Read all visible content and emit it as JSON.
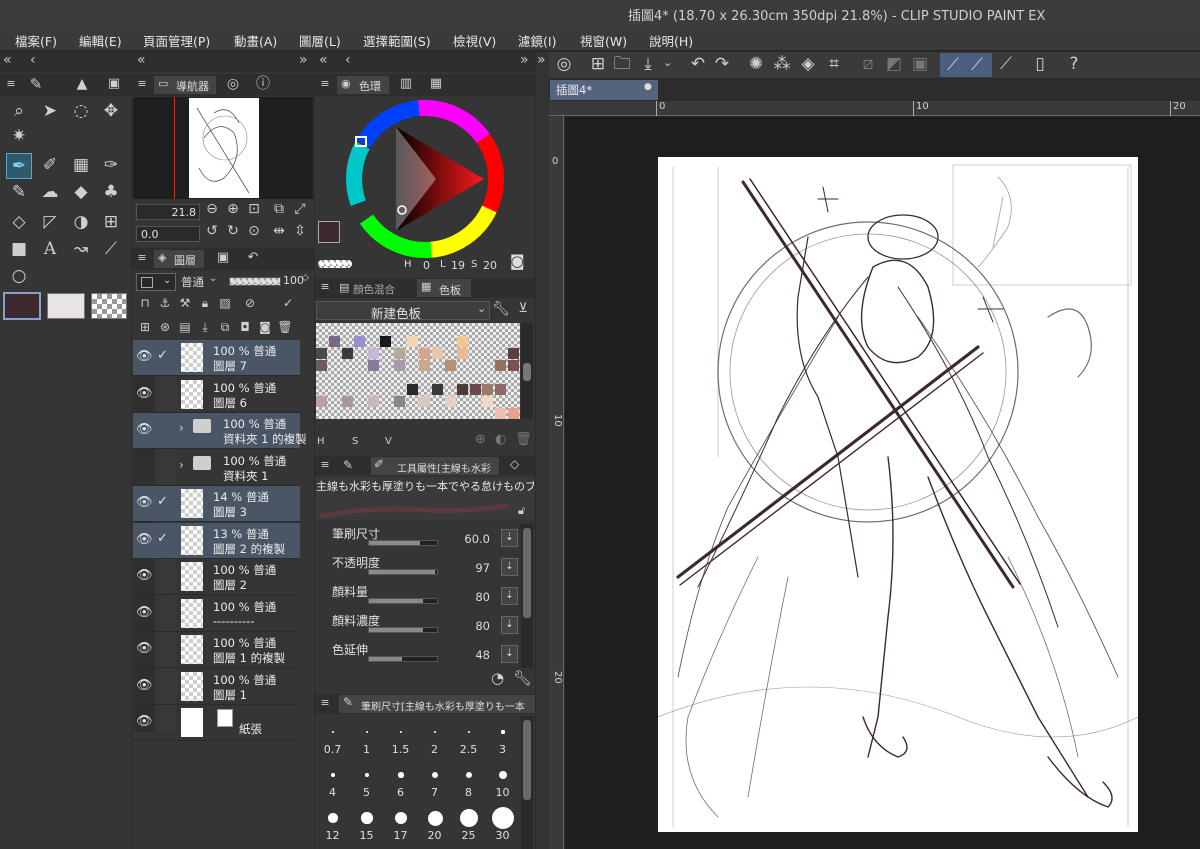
{
  "window": {
    "title": "插圖4* (18.70 x 26.30cm 350dpi 21.8%) - CLIP STUDIO PAINT EX"
  },
  "menu": [
    "檔案(F)",
    "編輯(E)",
    "頁面管理(P)",
    "動畫(A)",
    "圖層(L)",
    "選擇範圍(S)",
    "檢視(V)",
    "濾鏡(I)",
    "視窗(W)",
    "說明(H)"
  ],
  "navigator": {
    "tab": "導航器",
    "zoom": "21.8",
    "rotation": "0.0"
  },
  "color": {
    "tab": "色環",
    "h": "0",
    "l": "19",
    "s": "20",
    "main_color": "#3d2a2e",
    "sub_color": "#e8e4e6"
  },
  "layers": {
    "tab": "圖層",
    "blend": "普通",
    "opacity": "100",
    "rows": [
      {
        "line1": "100 % 普通",
        "line2": "圖層 7",
        "selected": true,
        "checked": true
      },
      {
        "line1": "100 % 普通",
        "line2": "圖層 6",
        "selected": false,
        "checked": false
      },
      {
        "line1": "100 % 普通",
        "line2": "資料夾 1 的複製",
        "selected": true,
        "checked": false,
        "folder": true
      },
      {
        "line1": "100 % 普通",
        "line2": "資料夾 1",
        "selected": false,
        "checked": false,
        "folder": true,
        "hidden": true
      },
      {
        "line1": "14 % 普通",
        "line2": "圖層 3",
        "selected": true,
        "checked": true
      },
      {
        "line1": "13 % 普通",
        "line2": "圖層 2 的複製",
        "selected": true,
        "checked": true
      },
      {
        "line1": "100 % 普通",
        "line2": "圖層 2",
        "selected": false,
        "checked": false
      },
      {
        "line1": "100 % 普通",
        "line2": "----------",
        "selected": false,
        "checked": false
      },
      {
        "line1": "100 % 普通",
        "line2": "圖層 1 的複製",
        "selected": false,
        "checked": false
      },
      {
        "line1": "100 % 普通",
        "line2": "圖層 1",
        "selected": false,
        "checked": false
      },
      {
        "line1": "",
        "line2": "紙張",
        "selected": false,
        "checked": false,
        "paper": true
      }
    ]
  },
  "palette": {
    "tab1": "顏色混合",
    "tab2": "色板",
    "set": "新建色板",
    "labels": [
      "H",
      "S",
      "V"
    ]
  },
  "tool_property": {
    "tab": "工具屬性[主線も水彩",
    "brush_name": "主線も水彩も厚塗りも一本でやる怠けものブラシ",
    "props": [
      {
        "label": "筆刷尺寸",
        "value": "60.0",
        "fill": 0.75
      },
      {
        "label": "不透明度",
        "value": "97",
        "fill": 0.97
      },
      {
        "label": "顏料量",
        "value": "80",
        "fill": 0.8
      },
      {
        "label": "顏料濃度",
        "value": "80",
        "fill": 0.8
      },
      {
        "label": "色延伸",
        "value": "48",
        "fill": 0.48
      }
    ]
  },
  "brush_size": {
    "tab": "筆刷尺寸[主線も水彩も厚塗りも一本",
    "sizes": [
      "0.7",
      "1",
      "1.5",
      "2",
      "2.5",
      "3",
      "4",
      "5",
      "6",
      "7",
      "8",
      "10",
      "12",
      "15",
      "17",
      "20",
      "25",
      "30"
    ]
  },
  "canvas": {
    "tab": "插圖4*",
    "ruler": [
      "0",
      "10",
      "20"
    ]
  }
}
